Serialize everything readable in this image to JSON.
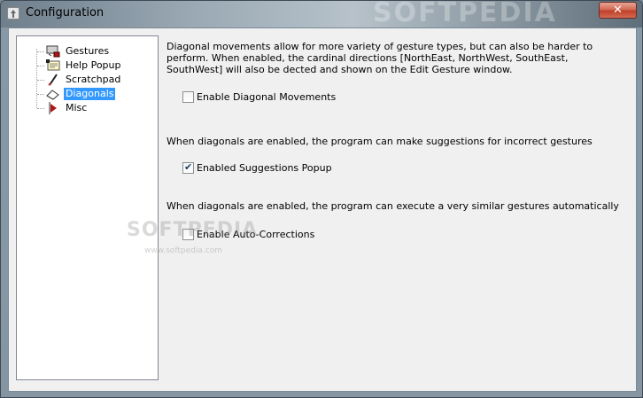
{
  "window": {
    "title": "Configuration",
    "close_label": "✕",
    "watermark": "SOFTPEDIA"
  },
  "sidebar": {
    "items": [
      {
        "label": "Gestures",
        "icon": "gestures-icon",
        "selected": false
      },
      {
        "label": "Help Popup",
        "icon": "help-popup-icon",
        "selected": false
      },
      {
        "label": "Scratchpad",
        "icon": "scratchpad-icon",
        "selected": false
      },
      {
        "label": "Diagonals",
        "icon": "diagonals-icon",
        "selected": true
      },
      {
        "label": "Misc",
        "icon": "misc-icon",
        "selected": false
      }
    ]
  },
  "main": {
    "description": "Diagonal movements allow for more variety of gesture types, but can also be harder to perform. When enabled, the cardinal directions [NorthEast, NorthWest, SouthEast, SouthWest] will also be dected and shown on the Edit Gesture window.",
    "diagonal_movements": {
      "label": "Enable Diagonal Movements",
      "checked": false
    },
    "suggestions_text": "When diagonals are enabled, the program can make suggestions for incorrect gestures",
    "suggestions_popup": {
      "label": "Enabled Suggestions Popup",
      "checked": true
    },
    "autocorrect_text": "When diagonals are enabled, the program can execute a very similar gestures automatically",
    "auto_corrections": {
      "label": "Enable Auto-Corrections",
      "checked": false
    }
  },
  "watermark": {
    "logo": "SOFTPEDIA",
    "url": "www.softpedia.com"
  },
  "colors": {
    "selection": "#3399ff",
    "close_button": "#c0402a"
  }
}
